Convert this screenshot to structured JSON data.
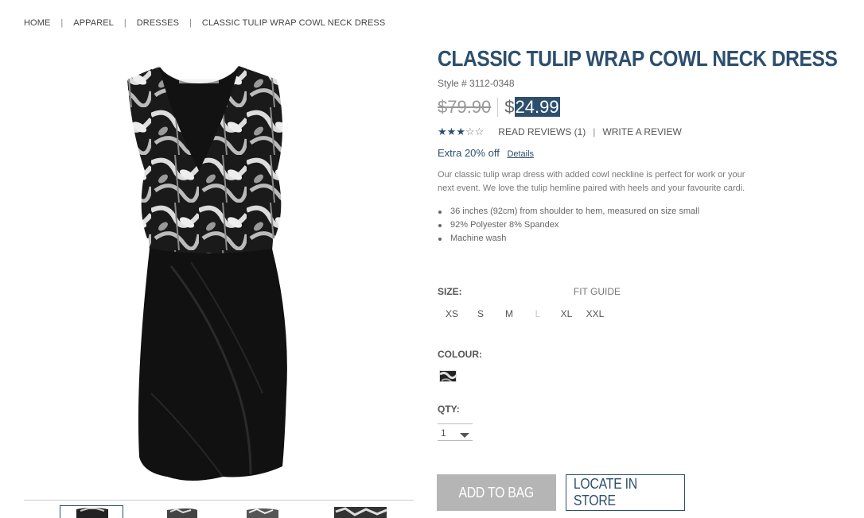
{
  "breadcrumb": {
    "items": [
      "HOME",
      "APPAREL",
      "DRESSES",
      "CLASSIC TULIP WRAP COWL NECK DRESS"
    ],
    "separator": "|"
  },
  "product": {
    "title": "CLASSIC TULIP WRAP COWL NECK DRESS",
    "style_number": "Style # 3112-0348",
    "old_price": "$79.90",
    "new_price_symbol": "$",
    "new_price_amount": "24.99",
    "rating": 3,
    "rating_max": 5,
    "read_reviews": "READ REVIEWS (1)",
    "write_review": "WRITE A REVIEW",
    "promo": "Extra 20% off",
    "promo_details": "Details",
    "description": "Our classic tulip wrap dress with added cowl neckline is perfect for work or your next event. We love the tulip hemline paired with heels and your favourite cardi.",
    "bullets": [
      "36 inches (92cm) from shoulder to hem, measured on size small",
      "92% Polyester 8% Spandex",
      "Machine wash"
    ]
  },
  "size": {
    "label": "SIZE:",
    "fit_guide": "FIT GUIDE",
    "options": [
      {
        "label": "XS",
        "available": true
      },
      {
        "label": "S",
        "available": true
      },
      {
        "label": "M",
        "available": true
      },
      {
        "label": "L",
        "available": false
      },
      {
        "label": "XL",
        "available": true
      },
      {
        "label": "XXL",
        "available": true
      }
    ]
  },
  "colour": {
    "label": "COLOUR:",
    "swatch": "black-white-floral-swatch"
  },
  "qty": {
    "label": "QTY:",
    "value": "1"
  },
  "buttons": {
    "add_to_bag": "ADD TO BAG",
    "locate_in_store": "LOCATE IN STORE"
  },
  "colors": {
    "accent": "#2d4f6e",
    "disabled_button": "#b5b5b5"
  }
}
